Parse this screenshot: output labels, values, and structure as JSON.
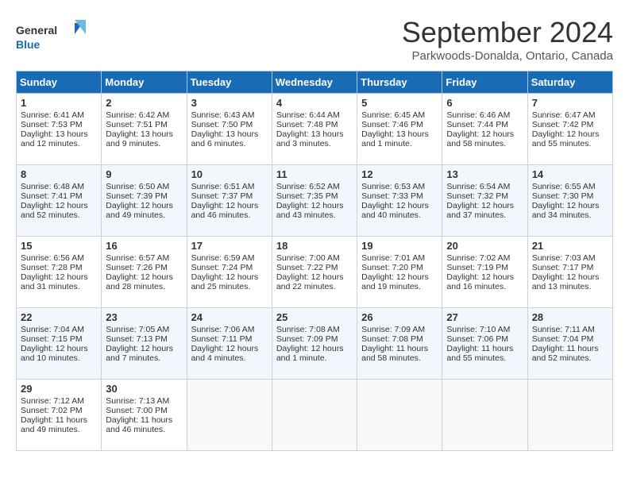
{
  "header": {
    "logo_line1": "General",
    "logo_line2": "Blue",
    "month_title": "September 2024",
    "location": "Parkwoods-Donalda, Ontario, Canada"
  },
  "days_of_week": [
    "Sunday",
    "Monday",
    "Tuesday",
    "Wednesday",
    "Thursday",
    "Friday",
    "Saturday"
  ],
  "weeks": [
    [
      {
        "num": "1",
        "lines": [
          "Sunrise: 6:41 AM",
          "Sunset: 7:53 PM",
          "Daylight: 13 hours",
          "and 12 minutes."
        ]
      },
      {
        "num": "2",
        "lines": [
          "Sunrise: 6:42 AM",
          "Sunset: 7:51 PM",
          "Daylight: 13 hours",
          "and 9 minutes."
        ]
      },
      {
        "num": "3",
        "lines": [
          "Sunrise: 6:43 AM",
          "Sunset: 7:50 PM",
          "Daylight: 13 hours",
          "and 6 minutes."
        ]
      },
      {
        "num": "4",
        "lines": [
          "Sunrise: 6:44 AM",
          "Sunset: 7:48 PM",
          "Daylight: 13 hours",
          "and 3 minutes."
        ]
      },
      {
        "num": "5",
        "lines": [
          "Sunrise: 6:45 AM",
          "Sunset: 7:46 PM",
          "Daylight: 13 hours",
          "and 1 minute."
        ]
      },
      {
        "num": "6",
        "lines": [
          "Sunrise: 6:46 AM",
          "Sunset: 7:44 PM",
          "Daylight: 12 hours",
          "and 58 minutes."
        ]
      },
      {
        "num": "7",
        "lines": [
          "Sunrise: 6:47 AM",
          "Sunset: 7:42 PM",
          "Daylight: 12 hours",
          "and 55 minutes."
        ]
      }
    ],
    [
      {
        "num": "8",
        "lines": [
          "Sunrise: 6:48 AM",
          "Sunset: 7:41 PM",
          "Daylight: 12 hours",
          "and 52 minutes."
        ]
      },
      {
        "num": "9",
        "lines": [
          "Sunrise: 6:50 AM",
          "Sunset: 7:39 PM",
          "Daylight: 12 hours",
          "and 49 minutes."
        ]
      },
      {
        "num": "10",
        "lines": [
          "Sunrise: 6:51 AM",
          "Sunset: 7:37 PM",
          "Daylight: 12 hours",
          "and 46 minutes."
        ]
      },
      {
        "num": "11",
        "lines": [
          "Sunrise: 6:52 AM",
          "Sunset: 7:35 PM",
          "Daylight: 12 hours",
          "and 43 minutes."
        ]
      },
      {
        "num": "12",
        "lines": [
          "Sunrise: 6:53 AM",
          "Sunset: 7:33 PM",
          "Daylight: 12 hours",
          "and 40 minutes."
        ]
      },
      {
        "num": "13",
        "lines": [
          "Sunrise: 6:54 AM",
          "Sunset: 7:32 PM",
          "Daylight: 12 hours",
          "and 37 minutes."
        ]
      },
      {
        "num": "14",
        "lines": [
          "Sunrise: 6:55 AM",
          "Sunset: 7:30 PM",
          "Daylight: 12 hours",
          "and 34 minutes."
        ]
      }
    ],
    [
      {
        "num": "15",
        "lines": [
          "Sunrise: 6:56 AM",
          "Sunset: 7:28 PM",
          "Daylight: 12 hours",
          "and 31 minutes."
        ]
      },
      {
        "num": "16",
        "lines": [
          "Sunrise: 6:57 AM",
          "Sunset: 7:26 PM",
          "Daylight: 12 hours",
          "and 28 minutes."
        ]
      },
      {
        "num": "17",
        "lines": [
          "Sunrise: 6:59 AM",
          "Sunset: 7:24 PM",
          "Daylight: 12 hours",
          "and 25 minutes."
        ]
      },
      {
        "num": "18",
        "lines": [
          "Sunrise: 7:00 AM",
          "Sunset: 7:22 PM",
          "Daylight: 12 hours",
          "and 22 minutes."
        ]
      },
      {
        "num": "19",
        "lines": [
          "Sunrise: 7:01 AM",
          "Sunset: 7:20 PM",
          "Daylight: 12 hours",
          "and 19 minutes."
        ]
      },
      {
        "num": "20",
        "lines": [
          "Sunrise: 7:02 AM",
          "Sunset: 7:19 PM",
          "Daylight: 12 hours",
          "and 16 minutes."
        ]
      },
      {
        "num": "21",
        "lines": [
          "Sunrise: 7:03 AM",
          "Sunset: 7:17 PM",
          "Daylight: 12 hours",
          "and 13 minutes."
        ]
      }
    ],
    [
      {
        "num": "22",
        "lines": [
          "Sunrise: 7:04 AM",
          "Sunset: 7:15 PM",
          "Daylight: 12 hours",
          "and 10 minutes."
        ]
      },
      {
        "num": "23",
        "lines": [
          "Sunrise: 7:05 AM",
          "Sunset: 7:13 PM",
          "Daylight: 12 hours",
          "and 7 minutes."
        ]
      },
      {
        "num": "24",
        "lines": [
          "Sunrise: 7:06 AM",
          "Sunset: 7:11 PM",
          "Daylight: 12 hours",
          "and 4 minutes."
        ]
      },
      {
        "num": "25",
        "lines": [
          "Sunrise: 7:08 AM",
          "Sunset: 7:09 PM",
          "Daylight: 12 hours",
          "and 1 minute."
        ]
      },
      {
        "num": "26",
        "lines": [
          "Sunrise: 7:09 AM",
          "Sunset: 7:08 PM",
          "Daylight: 11 hours",
          "and 58 minutes."
        ]
      },
      {
        "num": "27",
        "lines": [
          "Sunrise: 7:10 AM",
          "Sunset: 7:06 PM",
          "Daylight: 11 hours",
          "and 55 minutes."
        ]
      },
      {
        "num": "28",
        "lines": [
          "Sunrise: 7:11 AM",
          "Sunset: 7:04 PM",
          "Daylight: 11 hours",
          "and 52 minutes."
        ]
      }
    ],
    [
      {
        "num": "29",
        "lines": [
          "Sunrise: 7:12 AM",
          "Sunset: 7:02 PM",
          "Daylight: 11 hours",
          "and 49 minutes."
        ]
      },
      {
        "num": "30",
        "lines": [
          "Sunrise: 7:13 AM",
          "Sunset: 7:00 PM",
          "Daylight: 11 hours",
          "and 46 minutes."
        ]
      },
      {
        "num": "",
        "lines": []
      },
      {
        "num": "",
        "lines": []
      },
      {
        "num": "",
        "lines": []
      },
      {
        "num": "",
        "lines": []
      },
      {
        "num": "",
        "lines": []
      }
    ]
  ]
}
